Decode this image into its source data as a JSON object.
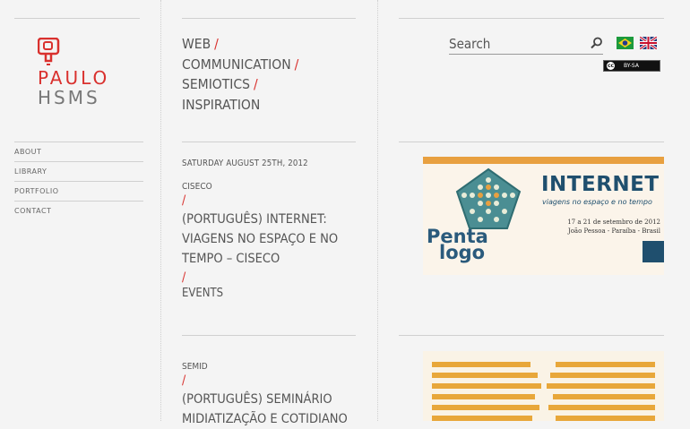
{
  "logo": {
    "line1": "PAULO",
    "line2": "HSMS"
  },
  "nav": {
    "items": [
      "ABOUT",
      "LIBRARY",
      "PORTFOLIO",
      "CONTACT"
    ]
  },
  "tagline": {
    "lines": [
      "WEB",
      "COMMUNICATION",
      "SEMIOTICS",
      "INSPIRATION"
    ],
    "separator": "/"
  },
  "posts": [
    {
      "date": "SATURDAY AUGUST 25TH, 2012",
      "category": "CISECO",
      "separator": "/",
      "title": "(PORTUGUÊS) INTERNET: VIAGENS NO ESPAÇO E NO TEMPO – CISECO",
      "tag": "EVENTS"
    },
    {
      "category": "SEMID",
      "separator": "/",
      "title": "(PORTUGUÊS) SEMINÁRIO MIDIATIZAÇÃO E COTIDIANO"
    }
  ],
  "search": {
    "placeholder": "Search"
  },
  "flags": [
    "flag-brazil-icon",
    "flag-uk-icon"
  ],
  "license": {
    "label": "BY-SA"
  },
  "thumb1": {
    "headline": "INTERNET",
    "subtitle": "viagens no espaço e no tempo",
    "date": "17 a 21 de setembro de 2012",
    "place": "João Pessoa - Paraíba - Brasil",
    "logo_line1": "Penta",
    "logo_line2": "logo"
  },
  "colors": {
    "accent": "#d9312e",
    "text": "#555555",
    "background": "#f4f4f4",
    "stripe": "#e8a73a"
  }
}
